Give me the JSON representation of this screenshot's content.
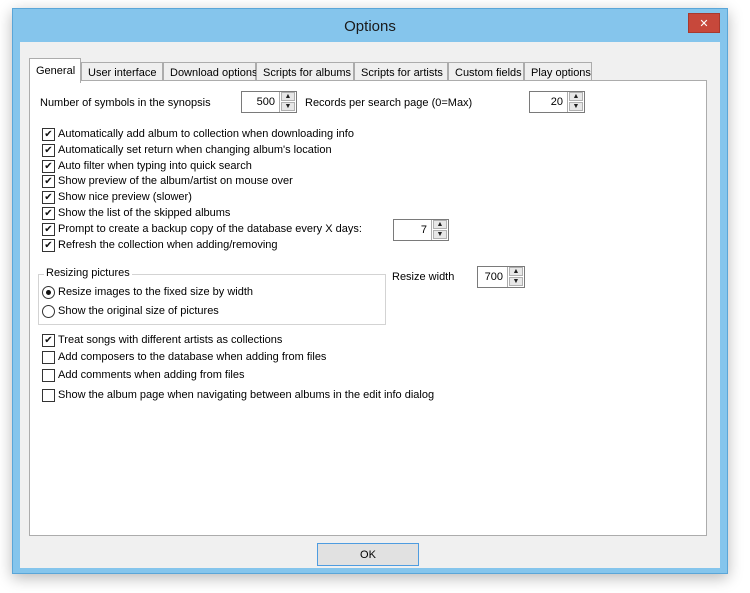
{
  "window": {
    "title": "Options",
    "close_glyph": "✕"
  },
  "tabs": [
    {
      "label": "General",
      "active": true
    },
    {
      "label": "User interface"
    },
    {
      "label": "Download options"
    },
    {
      "label": "Scripts for albums"
    },
    {
      "label": "Scripts for artists"
    },
    {
      "label": "Custom fields"
    },
    {
      "label": "Play options"
    }
  ],
  "general": {
    "synopsis_label": "Number of symbols in the synopsis",
    "synopsis_value": "500",
    "records_label": "Records per search page (0=Max)",
    "records_value": "20",
    "checkboxes": [
      {
        "label": "Automatically add album to collection when downloading info",
        "checked": true
      },
      {
        "label": "Automatically set return when changing album's location",
        "checked": true
      },
      {
        "label": "Auto filter when typing into quick search",
        "checked": true
      },
      {
        "label": "Show preview of the album/artist on mouse over",
        "checked": true
      },
      {
        "label": "Show nice preview (slower)",
        "checked": true
      },
      {
        "label": "Show the list of the skipped albums",
        "checked": true
      },
      {
        "label": "Prompt to create a backup copy of the database every X days:",
        "checked": true
      },
      {
        "label": "Refresh the collection when adding/removing",
        "checked": true
      }
    ],
    "backup_days_value": "7",
    "resizing": {
      "title": "Resizing pictures",
      "options": [
        {
          "label": "Resize images to the fixed size by width",
          "selected": true
        },
        {
          "label": "Show the original size of pictures",
          "selected": false
        }
      ]
    },
    "resize_width_label": "Resize width",
    "resize_width_value": "700",
    "checkboxes2": [
      {
        "label": "Treat songs with different artists as collections",
        "checked": true
      },
      {
        "label": "Add composers to the database when adding from files",
        "checked": false
      },
      {
        "label": "Add comments when adding from files",
        "checked": false
      },
      {
        "label": "Show the album page when navigating between albums in the edit info dialog",
        "checked": false
      }
    ]
  },
  "buttons": {
    "ok": "OK"
  },
  "spin_arrows": {
    "up": "▲",
    "down": "▼"
  }
}
